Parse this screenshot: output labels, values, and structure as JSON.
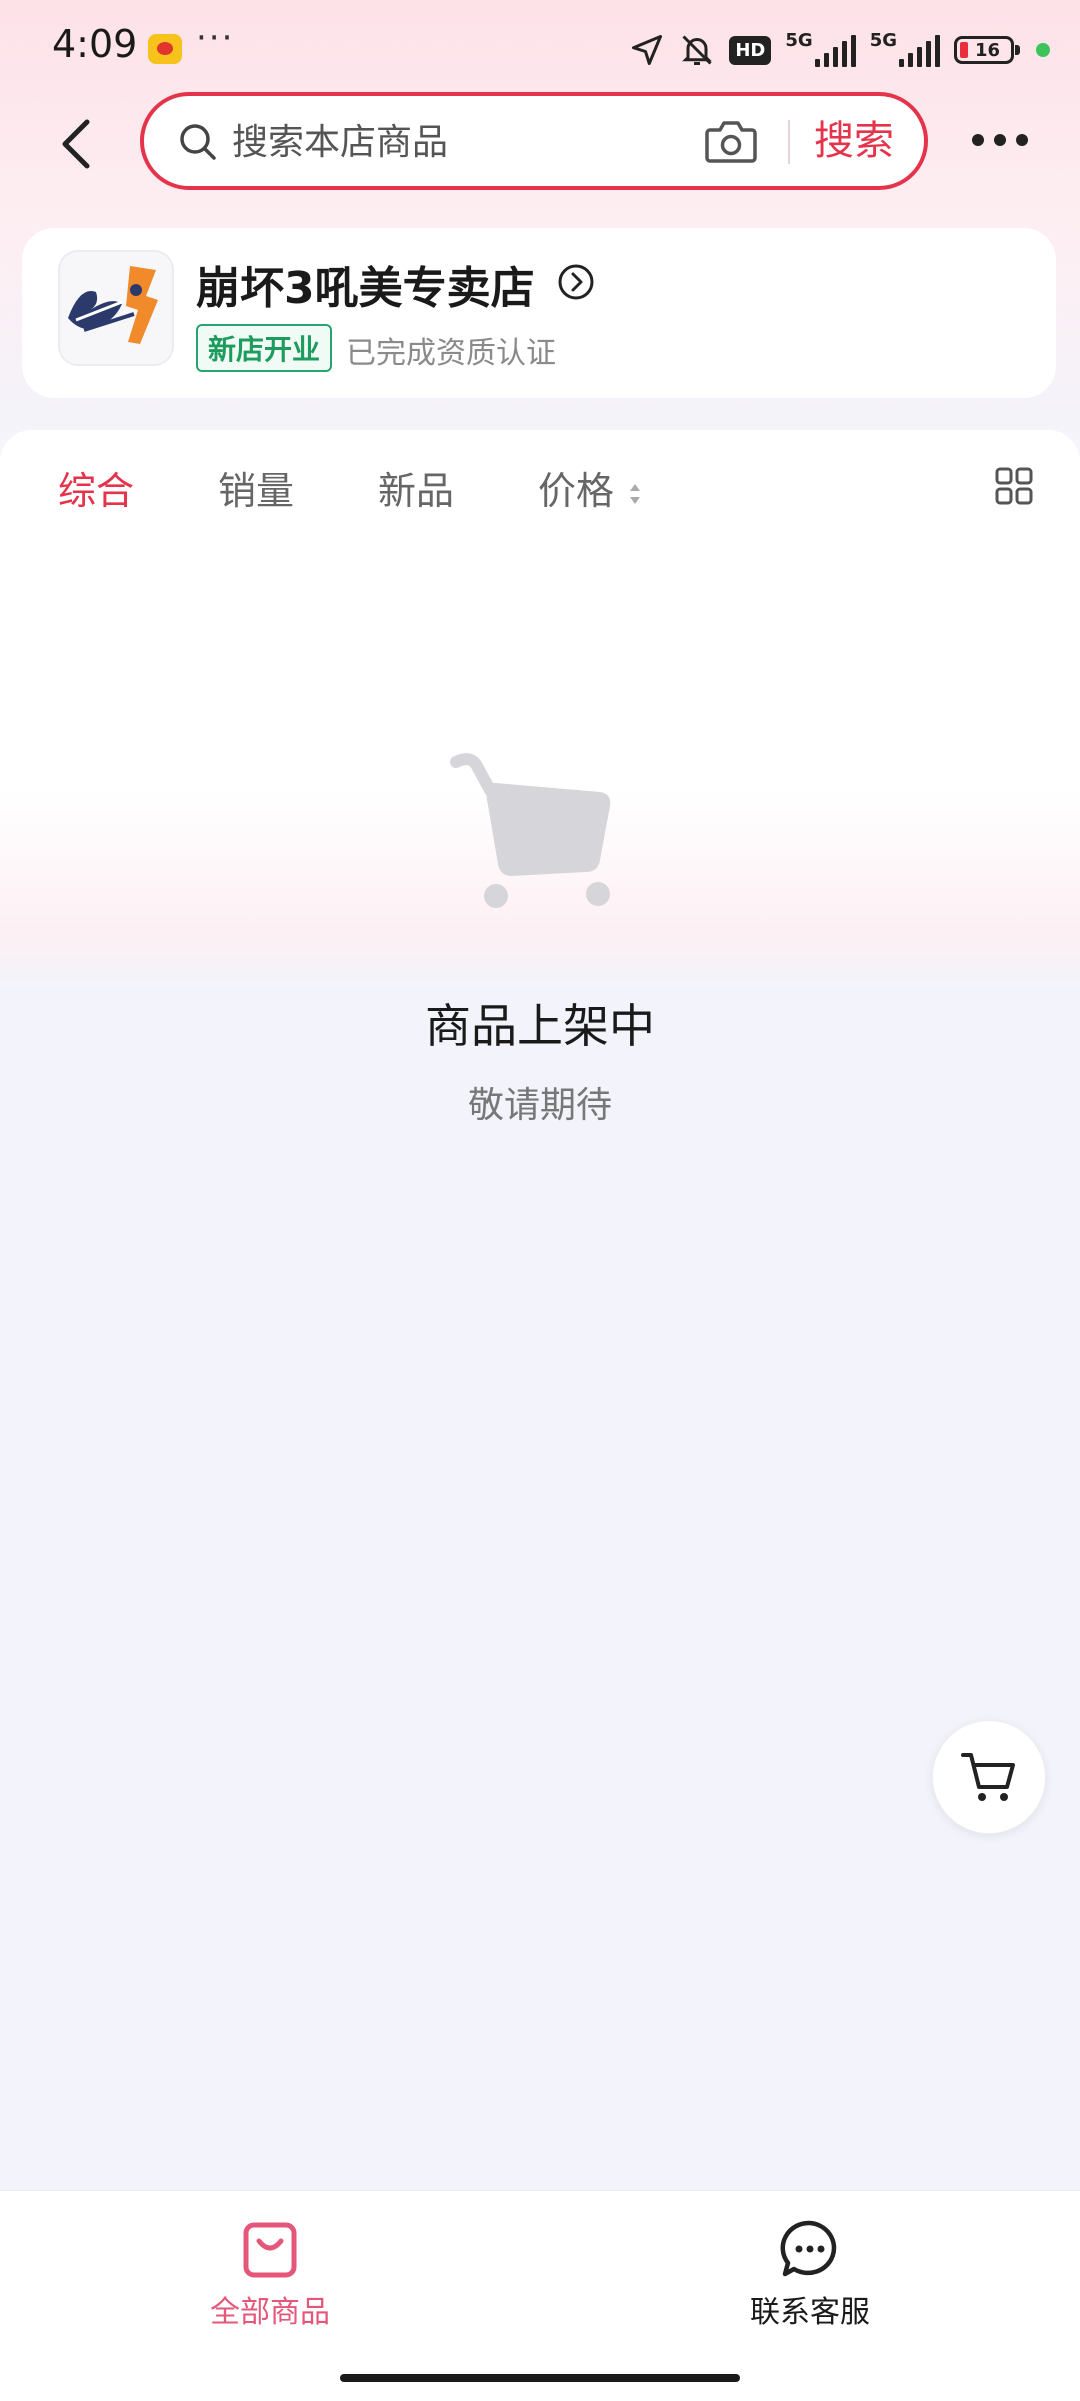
{
  "status_bar": {
    "time": "4:09",
    "network_1": "5G",
    "network_2": "5G",
    "hd_label": "HD",
    "battery_level": "16"
  },
  "header": {
    "search_placeholder": "搜索本店商品",
    "search_button": "搜索"
  },
  "shop": {
    "name": "崩坏3吼美专卖店",
    "badge": "新店开业",
    "verified_text": "已完成资质认证"
  },
  "tabs": [
    {
      "label": "综合",
      "active": true
    },
    {
      "label": "销量",
      "active": false
    },
    {
      "label": "新品",
      "active": false
    },
    {
      "label": "价格",
      "active": false
    }
  ],
  "empty_state": {
    "title": "商品上架中",
    "subtitle": "敬请期待"
  },
  "bottom_nav": {
    "all_products": "全部商品",
    "contact_service": "联系客服"
  },
  "colors": {
    "accent": "#e5334b",
    "tab_active": "#e5334b",
    "badge_green": "#1e9c5e",
    "nav_active": "#e5577a"
  },
  "icons": [
    "back-arrow-icon",
    "search-icon",
    "camera-icon",
    "more-dots-icon",
    "circle-arrow-right-icon",
    "sort-arrows-icon",
    "grid-view-icon",
    "empty-cart-icon",
    "shopping-cart-icon",
    "shopping-bag-icon",
    "chat-bubble-icon"
  ]
}
